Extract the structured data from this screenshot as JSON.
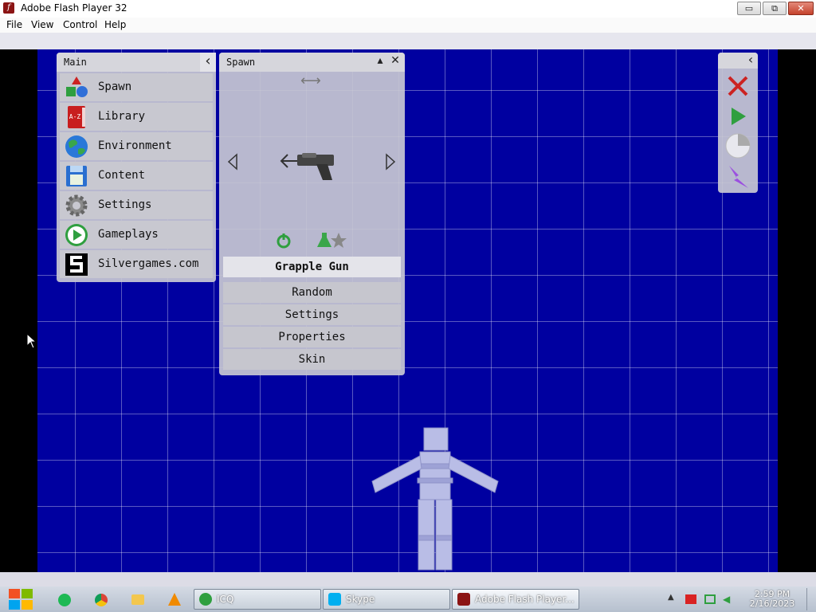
{
  "window": {
    "title": "Adobe Flash Player 32",
    "min": "▭",
    "max": "⧉",
    "close": "✕"
  },
  "menu": [
    "File",
    "View",
    "Control",
    "Help"
  ],
  "main_panel": {
    "title": "Main",
    "collapse_icon": "‹",
    "items": [
      {
        "label": "Spawn",
        "icon": "shapes-icon"
      },
      {
        "label": "Library",
        "icon": "book-icon"
      },
      {
        "label": "Environment",
        "icon": "globe-icon"
      },
      {
        "label": "Content",
        "icon": "floppy-icon"
      },
      {
        "label": "Settings",
        "icon": "gear-icon"
      },
      {
        "label": "Gameplays",
        "icon": "play-icon"
      },
      {
        "label": "Silvergames.com",
        "icon": "silvergames-logo-icon"
      }
    ]
  },
  "library_icon_text": "A-Z",
  "spawn_panel": {
    "title": "Spawn",
    "selected_item": "Grapple Gun",
    "buttons": [
      "Random",
      "Settings",
      "Properties",
      "Skin"
    ]
  },
  "colors": {
    "stage": "#0000a0",
    "accent_red": "#cc2222",
    "accent_green": "#2f9f3f",
    "accent_purple": "#9b4fe0"
  },
  "taskbar": {
    "tasks": [
      {
        "label": "ICQ",
        "icon": "icq-icon"
      },
      {
        "label": "Skype",
        "icon": "skype-icon"
      },
      {
        "label": "Adobe Flash Player...",
        "icon": "flash-icon"
      }
    ],
    "time": "2:59 PM",
    "date": "2/16/2023"
  }
}
